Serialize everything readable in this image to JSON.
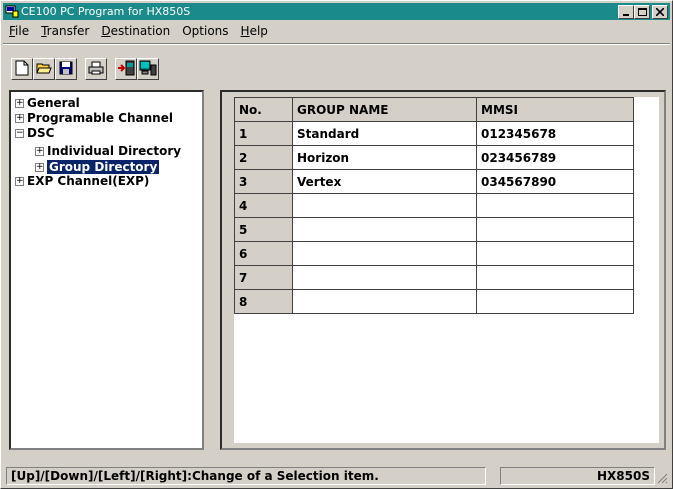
{
  "window": {
    "title": "CE100  PC Program for HX850S"
  },
  "menu": [
    {
      "label": "File",
      "underline": "F",
      "rest": "ile"
    },
    {
      "label": "Transfer",
      "underline": "T",
      "rest": "ransfer"
    },
    {
      "label": "Destination",
      "underline": "D",
      "rest": "estination"
    },
    {
      "label": "Options",
      "underline": "",
      "rest": "Options"
    },
    {
      "label": "Help",
      "underline": "H",
      "rest": "elp"
    }
  ],
  "toolbar": {
    "new": "new-file-icon",
    "open": "open-folder-icon",
    "save": "save-disk-icon",
    "print": "printer-icon",
    "read": "read-from-radio-icon",
    "write": "write-to-radio-icon"
  },
  "tree": {
    "general": "General",
    "programable": "Programable Channel",
    "dsc": "DSC",
    "individual": "Individual Directory",
    "group": "Group Directory",
    "exp": "EXP Channel(EXP)"
  },
  "grid": {
    "headers": {
      "no": "No.",
      "name": "GROUP NAME",
      "mmsi": "MMSI"
    },
    "rows": [
      {
        "no": "1",
        "name": "Standard",
        "mmsi": "012345678"
      },
      {
        "no": "2",
        "name": "Horizon",
        "mmsi": "023456789"
      },
      {
        "no": "3",
        "name": "Vertex",
        "mmsi": "034567890"
      },
      {
        "no": "4",
        "name": "",
        "mmsi": ""
      },
      {
        "no": "5",
        "name": "",
        "mmsi": ""
      },
      {
        "no": "6",
        "name": "",
        "mmsi": ""
      },
      {
        "no": "7",
        "name": "",
        "mmsi": ""
      },
      {
        "no": "8",
        "name": "",
        "mmsi": ""
      }
    ]
  },
  "status": {
    "hint": "[Up]/[Down]/[Left]/[Right]:Change of a Selection item.",
    "model": "HX850S"
  },
  "colors": {
    "titlebar": "#1a8a8a",
    "selection": "#0a246a",
    "face": "#d4d0c8"
  }
}
